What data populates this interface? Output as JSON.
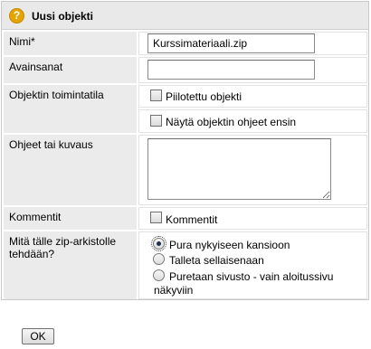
{
  "dialog": {
    "title": "Uusi objekti"
  },
  "form": {
    "name": {
      "label": "Nimi*",
      "value": "Kurssimateriaali.zip"
    },
    "keywords": {
      "label": "Avainsanat",
      "value": ""
    },
    "object_mode": {
      "label": "Objektin toimintatila",
      "hidden_object": {
        "label": "Piilotettu objekti",
        "checked": false
      },
      "show_instructions_first": {
        "label": "Näytä objektin ohjeet ensin",
        "checked": false
      }
    },
    "description": {
      "label": "Ohjeet tai kuvaus",
      "value": ""
    },
    "comments": {
      "label": "Kommentit",
      "checkbox_label": "Kommentit",
      "checked": false
    },
    "zip_action": {
      "label_line1": "Mitä tälle zip-arkistolle",
      "label_line2": "tehdään?",
      "options": [
        {
          "label": "Pura nykyiseen kansioon",
          "selected": true
        },
        {
          "label": "Talleta sellaisenaan",
          "selected": false
        },
        {
          "label_line1": "Puretaan sivusto - vain aloitussivu",
          "label_line2": "näkyviin",
          "selected": false
        }
      ]
    }
  },
  "buttons": {
    "ok": "OK"
  }
}
